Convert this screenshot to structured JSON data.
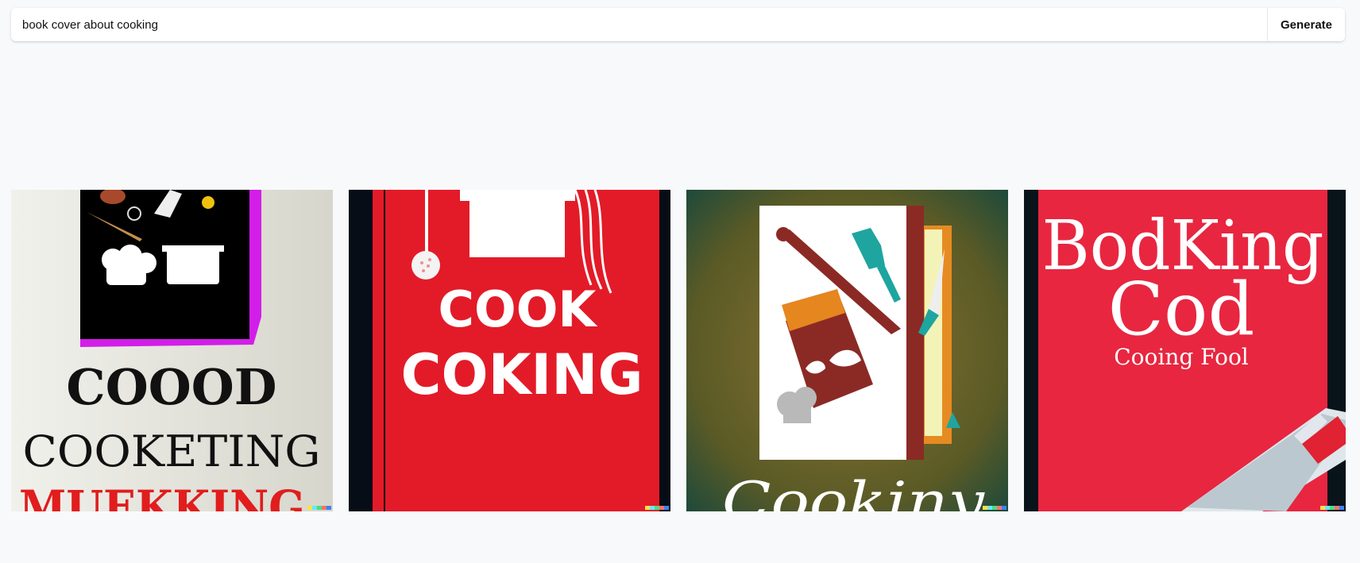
{
  "prompt": {
    "value": "book cover about cooking",
    "button_label": "Generate"
  },
  "results": [
    {
      "title": "COOOD",
      "subtitle": "COOKETING",
      "tagline": "MUEKKING"
    },
    {
      "title": "COOK",
      "subtitle": "COKING"
    },
    {
      "title": "Cookiny"
    },
    {
      "title": "BodKing",
      "subtitle": "Cod",
      "tagline": "Cooing Fool"
    }
  ],
  "watermark_colors": [
    "#fde047",
    "#67e8f9",
    "#4ade80",
    "#f87171",
    "#3b82f6"
  ]
}
